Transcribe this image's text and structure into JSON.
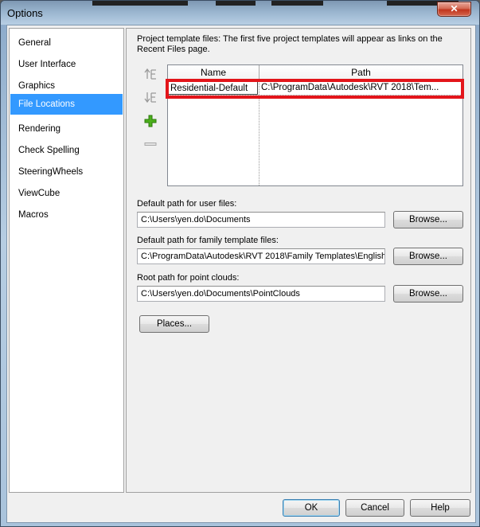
{
  "window": {
    "title": "Options",
    "close_glyph": "✕"
  },
  "nav": {
    "items": [
      {
        "label": "General"
      },
      {
        "label": "User Interface"
      },
      {
        "label": "Graphics"
      },
      {
        "label": "File Locations",
        "selected": true
      },
      {
        "label": "Rendering"
      },
      {
        "label": "Check Spelling"
      },
      {
        "label": "SteeringWheels"
      },
      {
        "label": "ViewCube"
      },
      {
        "label": "Macros"
      }
    ]
  },
  "templates": {
    "description": "Project template files:  The first five project templates will appear as links on the Recent Files page.",
    "tools": [
      "move-up-icon",
      "move-down-icon",
      "add-icon",
      "remove-icon"
    ],
    "columns": {
      "name": "Name",
      "path": "Path"
    },
    "rows": [
      {
        "name": "Residential-Default",
        "path": "C:\\ProgramData\\Autodesk\\RVT 2018\\Tem..."
      }
    ]
  },
  "user_files": {
    "label": "Default path for user files:",
    "value": "C:\\Users\\yen.do\\Documents",
    "browse": "Browse..."
  },
  "family_templates": {
    "label": "Default path for family template files:",
    "value": "C:\\ProgramData\\Autodesk\\RVT 2018\\Family Templates\\English",
    "browse": "Browse..."
  },
  "point_clouds": {
    "label": "Root path for point clouds:",
    "value": "C:\\Users\\yen.do\\Documents\\PointClouds",
    "browse": "Browse..."
  },
  "places_button": "Places...",
  "footer": {
    "ok": "OK",
    "cancel": "Cancel",
    "help": "Help"
  },
  "colors": {
    "selection": "#3399ff",
    "highlight_box": "#e3151a",
    "add_icon": "#4caf1c"
  }
}
